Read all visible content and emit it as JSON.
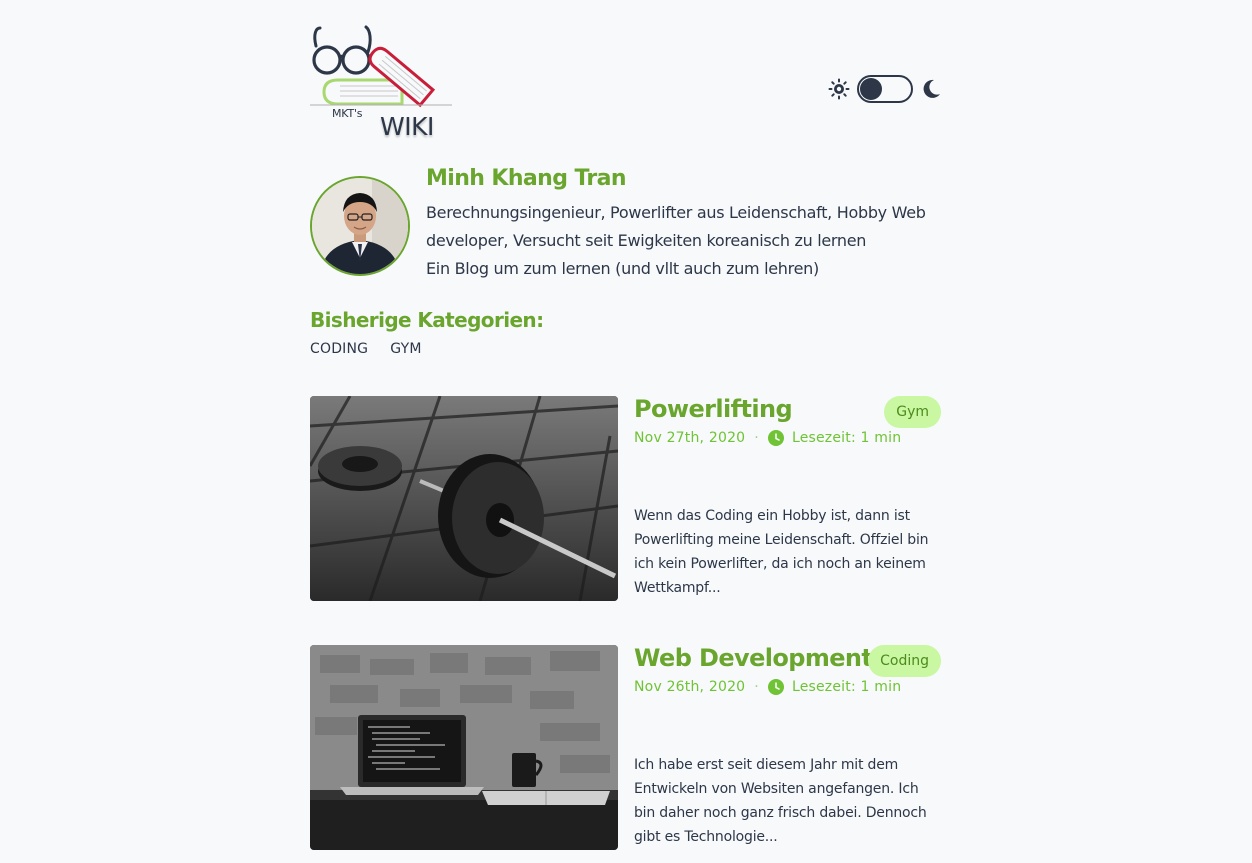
{
  "header": {
    "logo_mkt": "MKT's",
    "logo_wiki": "WIKI"
  },
  "theme_toggle": {
    "sun_icon": "sun-icon",
    "moon_icon": "moon-icon",
    "mode": "light"
  },
  "profile": {
    "name": "Minh Khang Tran",
    "bio_line1": "Berechnungsingenieur, Powerlifter aus Leidenschaft, Hobby Web developer, Versucht seit Ewigkeiten koreanisch zu lernen",
    "bio_line2": "Ein Blog um zum lernen (und vllt auch zum lehren)"
  },
  "categories": {
    "heading": "Bisherige Kategorien:",
    "items": [
      "CODING",
      "GYM"
    ]
  },
  "posts": [
    {
      "title": "Powerlifting",
      "tag": "Gym",
      "date": "Nov 27th, 2020",
      "separator": "·",
      "reading_time": "Lesezeit: 1 min",
      "excerpt": "Wenn das Coding ein Hobby ist, dann ist Powerlifting meine Leidenschaft. Offziel bin ich kein Powerlifter, da ich noch an keinem Wettkampf..."
    },
    {
      "title": "Web Development",
      "tag": "Coding",
      "date": "Nov 26th, 2020",
      "separator": "·",
      "reading_time": "Lesezeit: 1 min",
      "excerpt": "Ich habe erst seit diesem Jahr mit dem Entwickeln von Websiten angefangen. Ich bin daher noch ganz frisch dabei. Dennoch gibt es Technologie..."
    }
  ],
  "colors": {
    "accent_green": "#6aa52e",
    "tag_bg": "#c9f7a2",
    "meta_green": "#6fc334",
    "text_dark": "#2d3748",
    "background": "#f7f9fb"
  }
}
